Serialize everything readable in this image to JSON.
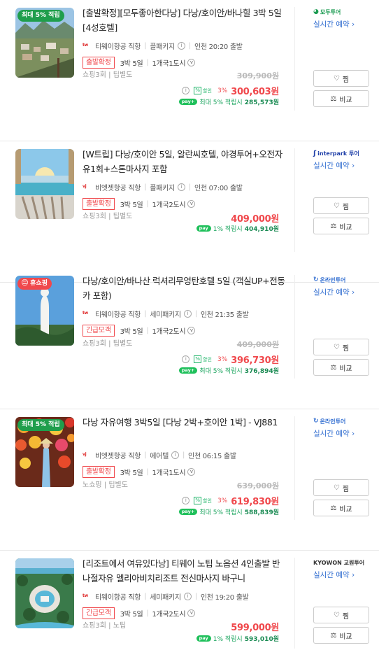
{
  "colors": {
    "price": "#f0484c",
    "accent_green": "#1fc05b",
    "link": "#2f6cd0"
  },
  "products": [
    {
      "badge": "최대 5% 적립",
      "badge_color": "green",
      "title": "[출발확정][모두좋아한다낭] 다낭/호이안/바나힐 3박 5일 [4성호텔]",
      "airline": "티웨이항공 직항",
      "package_type": "플패키지",
      "departure": "인천 20:20 출발",
      "status": "출발확정",
      "duration": "3박 5일",
      "cities": "1개국1도시",
      "extras": "쇼핑3회 | 팁별도",
      "original_price": "309,900원",
      "discount_label": "할인",
      "discount_rate": "3%",
      "price": "300,603원",
      "points_text": "최대 5% 적립시",
      "points_value": "285,573원",
      "agency": "모두투어",
      "agency_color": "#1c9b52",
      "realtime_label": "실시간 예약 ›",
      "wish_label": "찜",
      "compare_label": "비교"
    },
    {
      "badge": "",
      "badge_color": "",
      "title": "[W트립] 다낭/호이안 5일, 알란씨호텔, 야경투어+오전자유1회+스톤마사지 포함",
      "airline": "비엣젯항공 직항",
      "package_type": "플패키지",
      "departure": "인천 07:00 출발",
      "status": "출발확정",
      "duration": "3박 5일",
      "cities": "1개국2도시",
      "extras": "쇼핑3회 | 팁별도",
      "original_price": "",
      "discount_label": "",
      "discount_rate": "",
      "price": "409,000원",
      "points_text": "1% 적립시",
      "points_value": "404,910원",
      "agency": "interpark 투어",
      "agency_color": "#1f3fa8",
      "realtime_label": "실시간 예약 ›",
      "wish_label": "찜",
      "compare_label": "비교"
    },
    {
      "badge": "휴쇼핑",
      "badge_color": "red",
      "title": "다낭/호이안/바나산 럭셔리무엉탄호텔 5일 (객실UP+전동카 포함)",
      "airline": "티웨이항공 직항",
      "package_type": "세미패키지",
      "departure": "인천 21:35 출발",
      "status": "긴급모객",
      "duration": "3박 5일",
      "cities": "1개국2도시",
      "extras": "쇼핑3회 | 팁별도",
      "original_price": "409,000원",
      "discount_label": "할인",
      "discount_rate": "3%",
      "price": "396,730원",
      "points_text": "최대 5% 적립시",
      "points_value": "376,894원",
      "agency": "온라인투어",
      "agency_color": "#2f6cd0",
      "realtime_label": "실시간 예약 ›",
      "wish_label": "찜",
      "compare_label": "비교"
    },
    {
      "badge": "최대 5% 적립",
      "badge_color": "green",
      "title": "다낭 자유여행 3박5일 [다낭 2박+호이안 1박] - VJ881",
      "airline": "비엣젯항공 직항",
      "package_type": "에어텔",
      "departure": "인천 06:15 출발",
      "status": "출발확정",
      "duration": "3박 5일",
      "cities": "1개국1도시",
      "extras": "노쇼핑 | 팁별도",
      "original_price": "639,000원",
      "discount_label": "할인",
      "discount_rate": "3%",
      "price": "619,830원",
      "points_text": "최대 5% 적립시",
      "points_value": "588,839원",
      "agency": "온라인투어",
      "agency_color": "#2f6cd0",
      "realtime_label": "실시간 예약 ›",
      "wish_label": "찜",
      "compare_label": "비교"
    },
    {
      "badge": "",
      "badge_color": "",
      "title": "[리조트에서 여유있다낭] 티웨이 노팁 노옵션 4인출발 반나절자유 멜리아비치리조트 전신마사지 바구니",
      "airline": "티웨이항공 직항",
      "package_type": "세미패키지",
      "departure": "인천 19:20 출발",
      "status": "긴급모객",
      "duration": "3박 5일",
      "cities": "1개국2도시",
      "extras": "쇼핑3회 | 노팁",
      "original_price": "",
      "discount_label": "",
      "discount_rate": "",
      "price": "599,000원",
      "points_text": "1% 적립시",
      "points_value": "593,010원",
      "agency": "KYOWON 교원투어",
      "agency_color": "#333333",
      "realtime_label": "실시간 예약 ›",
      "wish_label": "찜",
      "compare_label": "비교"
    }
  ]
}
